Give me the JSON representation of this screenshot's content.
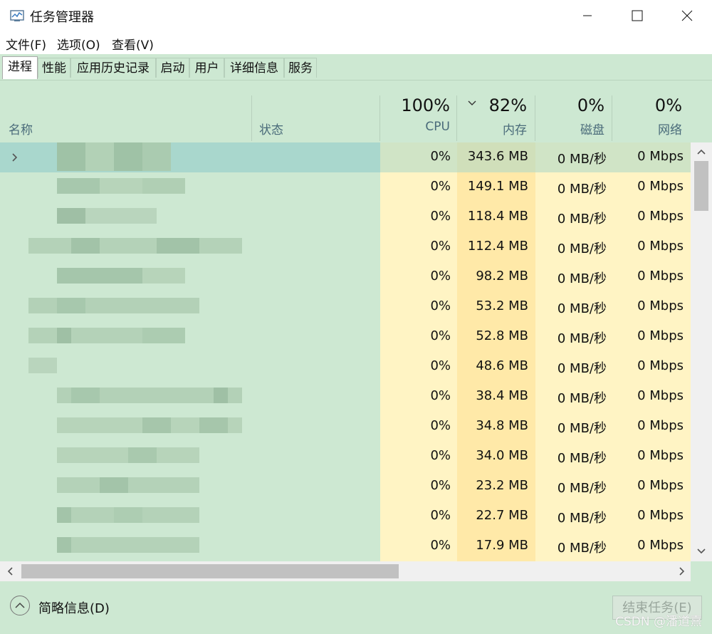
{
  "window": {
    "title": "任务管理器"
  },
  "menu": [
    "文件(F)",
    "选项(O)",
    "查看(V)"
  ],
  "tabs": [
    "进程",
    "性能",
    "应用历史记录",
    "启动",
    "用户",
    "详细信息",
    "服务"
  ],
  "columns": {
    "name": "名称",
    "status": "状态",
    "cpu": {
      "pct": "100%",
      "label": "CPU"
    },
    "memory": {
      "pct": "82%",
      "label": "内存"
    },
    "disk": {
      "pct": "0%",
      "label": "磁盘"
    },
    "network": {
      "pct": "0%",
      "label": "网络"
    }
  },
  "rows": [
    {
      "cpu": "0%",
      "mem": "343.6 MB",
      "disk": "0 MB/秒",
      "net": "0 Mbps"
    },
    {
      "cpu": "0%",
      "mem": "149.1 MB",
      "disk": "0 MB/秒",
      "net": "0 Mbps"
    },
    {
      "cpu": "0%",
      "mem": "118.4 MB",
      "disk": "0 MB/秒",
      "net": "0 Mbps"
    },
    {
      "cpu": "0%",
      "mem": "112.4 MB",
      "disk": "0 MB/秒",
      "net": "0 Mbps"
    },
    {
      "cpu": "0%",
      "mem": "98.2 MB",
      "disk": "0 MB/秒",
      "net": "0 Mbps"
    },
    {
      "cpu": "0%",
      "mem": "53.2 MB",
      "disk": "0 MB/秒",
      "net": "0 Mbps"
    },
    {
      "cpu": "0%",
      "mem": "52.8 MB",
      "disk": "0 MB/秒",
      "net": "0 Mbps"
    },
    {
      "cpu": "0%",
      "mem": "48.6 MB",
      "disk": "0 MB/秒",
      "net": "0 Mbps"
    },
    {
      "cpu": "0%",
      "mem": "38.4 MB",
      "disk": "0 MB/秒",
      "net": "0 Mbps"
    },
    {
      "cpu": "0%",
      "mem": "34.8 MB",
      "disk": "0 MB/秒",
      "net": "0 Mbps"
    },
    {
      "cpu": "0%",
      "mem": "34.0 MB",
      "disk": "0 MB/秒",
      "net": "0 Mbps"
    },
    {
      "cpu": "0%",
      "mem": "23.2 MB",
      "disk": "0 MB/秒",
      "net": "0 Mbps"
    },
    {
      "cpu": "0%",
      "mem": "22.7 MB",
      "disk": "0 MB/秒",
      "net": "0 Mbps"
    },
    {
      "cpu": "0%",
      "mem": "17.9 MB",
      "disk": "0 MB/秒",
      "net": "0 Mbps"
    }
  ],
  "footer": {
    "fewer_details": "简略信息(D)",
    "end_task": "结束任务(E)"
  },
  "watermark": "CSDN @潘道熹",
  "colors": {
    "background": "#cde8d2",
    "cpu_heat": "#fff4c4",
    "mem_heat": "#ffe9a8",
    "selected": "#a9d7cd"
  }
}
